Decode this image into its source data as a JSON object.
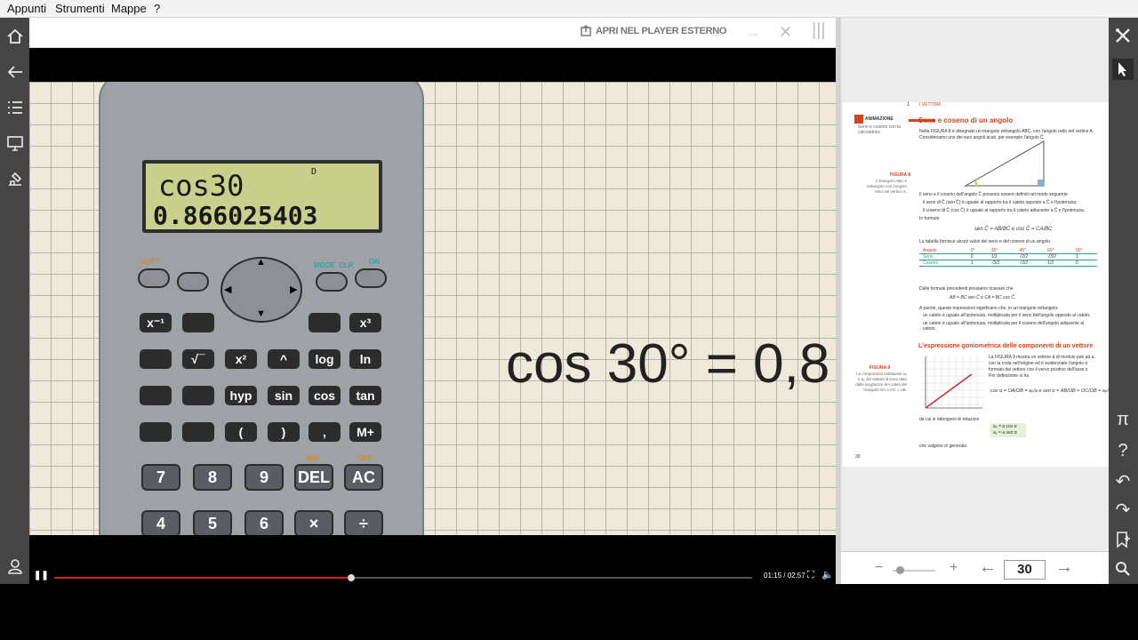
{
  "menu": [
    "Appunti",
    "Strumenti",
    "Mappe",
    "?"
  ],
  "player": {
    "open_external": "APRI NEL PLAYER ESTERNO",
    "time": "01:15 / 02:57",
    "progress": 0.425
  },
  "calculator": {
    "display_line1": "cos30",
    "display_line2": "0.866025403",
    "display_indicator": "D",
    "labels": {
      "shift": "SHIFT",
      "mode": "MODE",
      "clr": "CLR",
      "on": "ON",
      "ins": "INS",
      "off": "OFF"
    },
    "keys_row2": [
      "x⁻¹",
      "",
      "",
      "x³"
    ],
    "keys_row3": [
      "",
      "√¯",
      "x²",
      "^",
      "log",
      "ln"
    ],
    "keys_row4": [
      "",
      "",
      "hyp",
      "sin",
      "cos",
      "tan"
    ],
    "keys_row5": [
      "",
      "",
      "(",
      ")",
      ",",
      "M+"
    ],
    "keys_row6": [
      "7",
      "8",
      "9",
      "DEL",
      "AC"
    ],
    "keys_row7": [
      "4",
      "5",
      "6",
      "×",
      "÷"
    ]
  },
  "video_text": "cos 30° = 0,8",
  "book": {
    "chapter": "I VETTORI",
    "section_title": "Seno e coseno di un angolo",
    "animation_label": "ANIMAZIONE",
    "animation_caption": "Seno e coseno con la calcolatrice",
    "fig_label1": "FIGURA 8",
    "fig_caption1": "Il triangolo ABC è rettangolo con l'angolo retto nel vertice A.",
    "para1": "Nella FIGURA 8 è disegnato un triangolo rettangolo ABC, con l'angolo retto nel vertice A. Consideriamo uno dei suoi angoli acuti, per esempio l'angolo Ĉ.",
    "para2": "Il seno e il coseno dell'angolo Ĉ possono essere definiti nel modo seguente:",
    "bullet1": "il seno di Ĉ (sen Ĉ) è uguale al rapporto tra il cateto opposto a Ĉ e l'ipotenusa;",
    "bullet2": "il coseno di Ĉ (cos Ĉ) è uguale al rapporto tra il cateto adiacente a Ĉ e l'ipotenusa.",
    "formulas_intro": "In formule:",
    "table_intro": "La tabella fornisce alcuni valori del seno e del coseno di un angolo.",
    "table_headers": [
      "Angolo →",
      "0°",
      "30°",
      "45°",
      "60°",
      "90°"
    ],
    "table_seno": [
      "Seno",
      "0",
      "1/2",
      "√2/2",
      "√3/2",
      "1"
    ],
    "table_coseno": [
      "Coseno",
      "1",
      "√3/2",
      "√2/2",
      "1/2",
      "0"
    ],
    "para3": "Dalle formule precedenti possiamo ricavare che",
    "formula2": "AB = BC sen Ĉ   e   CA = BC cos Ĉ.",
    "para4": "A parole, queste espressioni significano che, in un triangolo rettangolo:",
    "bullet3": "un cateto è uguale all'ipotenusa, moltiplicata per il seno dell'angolo opposto al cateto;",
    "bullet4": "un cateto è uguale all'ipotenusa, moltiplicata per il coseno dell'angolo adiacente al cateto.",
    "section2_title": "L'espressione goniometrica delle componenti di un vettore",
    "fig_label2": "FIGURA 9",
    "fig_caption2": "Le componenti cartesiane aₓ e aᵧ del vettore a⃗ sono date dalle lunghezze dei cateti del triangolo OA e OC = AB.",
    "para5": "La FIGURA 9 mostra un vettore a⃗ di modulo pari ad a, con la coda nell'origine ed è evidenziato l'angolo α formato dal vettore con il verso positivo dell'asse x. Per definizione si ha",
    "para6": "da cui si ottengono le relazioni",
    "para7": "che valgono in generale.",
    "page_number_printed": "30"
  },
  "pager": {
    "page": "30",
    "minus": "−",
    "plus": "+"
  }
}
